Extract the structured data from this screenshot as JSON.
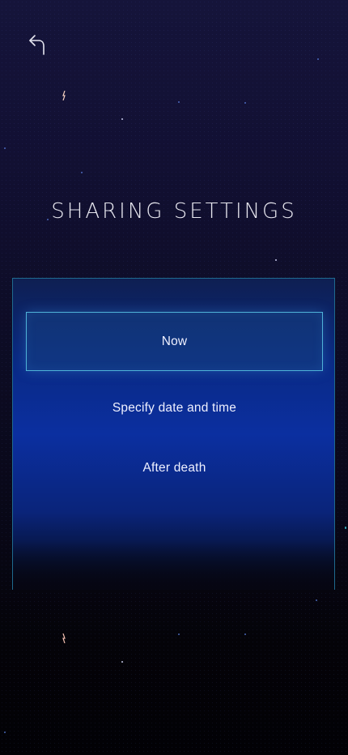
{
  "header": {
    "back_icon": "back-arrow-icon",
    "title": "SHARING SETTINGS"
  },
  "options": [
    {
      "label": "Now",
      "selected": true
    },
    {
      "label": "Specify date and time",
      "selected": false
    },
    {
      "label": "After death",
      "selected": false
    }
  ],
  "colors": {
    "accent_border": "#4fb2d8",
    "panel_blue": "#0b2fa0",
    "background": "#121033",
    "text": "#eef0ff"
  }
}
